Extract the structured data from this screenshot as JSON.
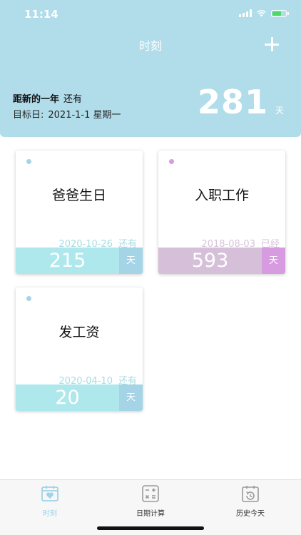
{
  "status": {
    "time": "11:14"
  },
  "header": {
    "title": "时刻",
    "target_label": "距新的一年",
    "target_suffix": "还有",
    "target_date_label": "目标日:",
    "target_date": "2021-1-1 星期一",
    "days": "281",
    "days_unit": "天"
  },
  "colors": {
    "header_bg": "#b1dcea",
    "cyan_bar": "#aee8ec",
    "cyan_unit": "#a4d4e6",
    "cyan_dot": "#a4d4e6",
    "cyan_text": "#a6dde4",
    "purple_bar": "#d6bfd9",
    "purple_unit": "#d79be0",
    "purple_dot": "#d79be0",
    "purple_text": "#d8c2db"
  },
  "cards": [
    {
      "name": "爸爸生日",
      "date": "2020-10-26",
      "status": "还有",
      "count": "215",
      "unit": "天",
      "theme": "cyan"
    },
    {
      "name": "入职工作",
      "date": "2018-08-03",
      "status": "已经",
      "count": "593",
      "unit": "天",
      "theme": "purple"
    },
    {
      "name": "发工资",
      "date": "2020-04-10",
      "status": "还有",
      "count": "20",
      "unit": "天",
      "theme": "cyan"
    }
  ],
  "tabs": [
    {
      "label": "时刻",
      "icon": "calendar-heart-icon",
      "active": true
    },
    {
      "label": "日期计算",
      "icon": "calculator-icon",
      "active": false
    },
    {
      "label": "历史今天",
      "icon": "calendar-history-icon",
      "active": false
    }
  ]
}
